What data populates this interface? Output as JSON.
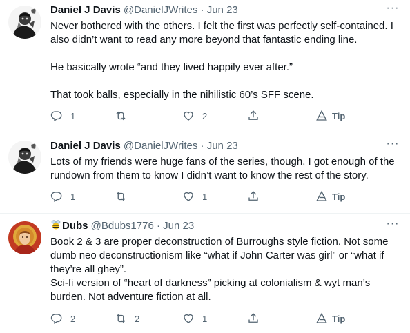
{
  "tweets": [
    {
      "name": "Daniel J Davis",
      "handle": "@DanielJWrites",
      "separator": "·",
      "date": "Jun 23",
      "more": "···",
      "paragraphs": [
        "Never bothered with the others. I felt the first was perfectly self-contained. I also didn’t want to read any more beyond that fantastic ending line.",
        "He basically wrote “and they lived happily ever after.”",
        "That took balls, especially in the nihilistic 60’s SFF scene."
      ],
      "replies": "1",
      "retweets": "",
      "likes": "2",
      "tip_label": "Tip"
    },
    {
      "name": "Daniel J Davis",
      "handle": "@DanielJWrites",
      "separator": "·",
      "date": "Jun 23",
      "more": "···",
      "paragraphs": [
        "Lots of my friends were huge fans of the series, though. I got enough of the rundown from them to know I didn’t want to know the rest of the story."
      ],
      "replies": "1",
      "retweets": "",
      "likes": "1",
      "tip_label": "Tip"
    },
    {
      "name": "Dubs",
      "name_emoji": "bee-icon",
      "handle": "@Bdubs1776",
      "separator": "·",
      "date": "Jun 23",
      "more": "···",
      "paragraphs": [
        "Book 2 & 3 are proper deconstruction of Burroughs style fiction. Not some dumb neo deconstructionism like “what if John Carter was girl” or “what if they’re all ghey”.",
        "Sci-fi version of “heart of darkness” picking at colonialism & wyt man’s burden. Not adventure fiction at all."
      ],
      "replies": "2",
      "retweets": "2",
      "likes": "1",
      "tip_label": "Tip"
    }
  ],
  "colors": {
    "text": "#0f1419",
    "secondary": "#536471",
    "divider": "#eff3f4",
    "avatar_red": "#c23a22"
  }
}
